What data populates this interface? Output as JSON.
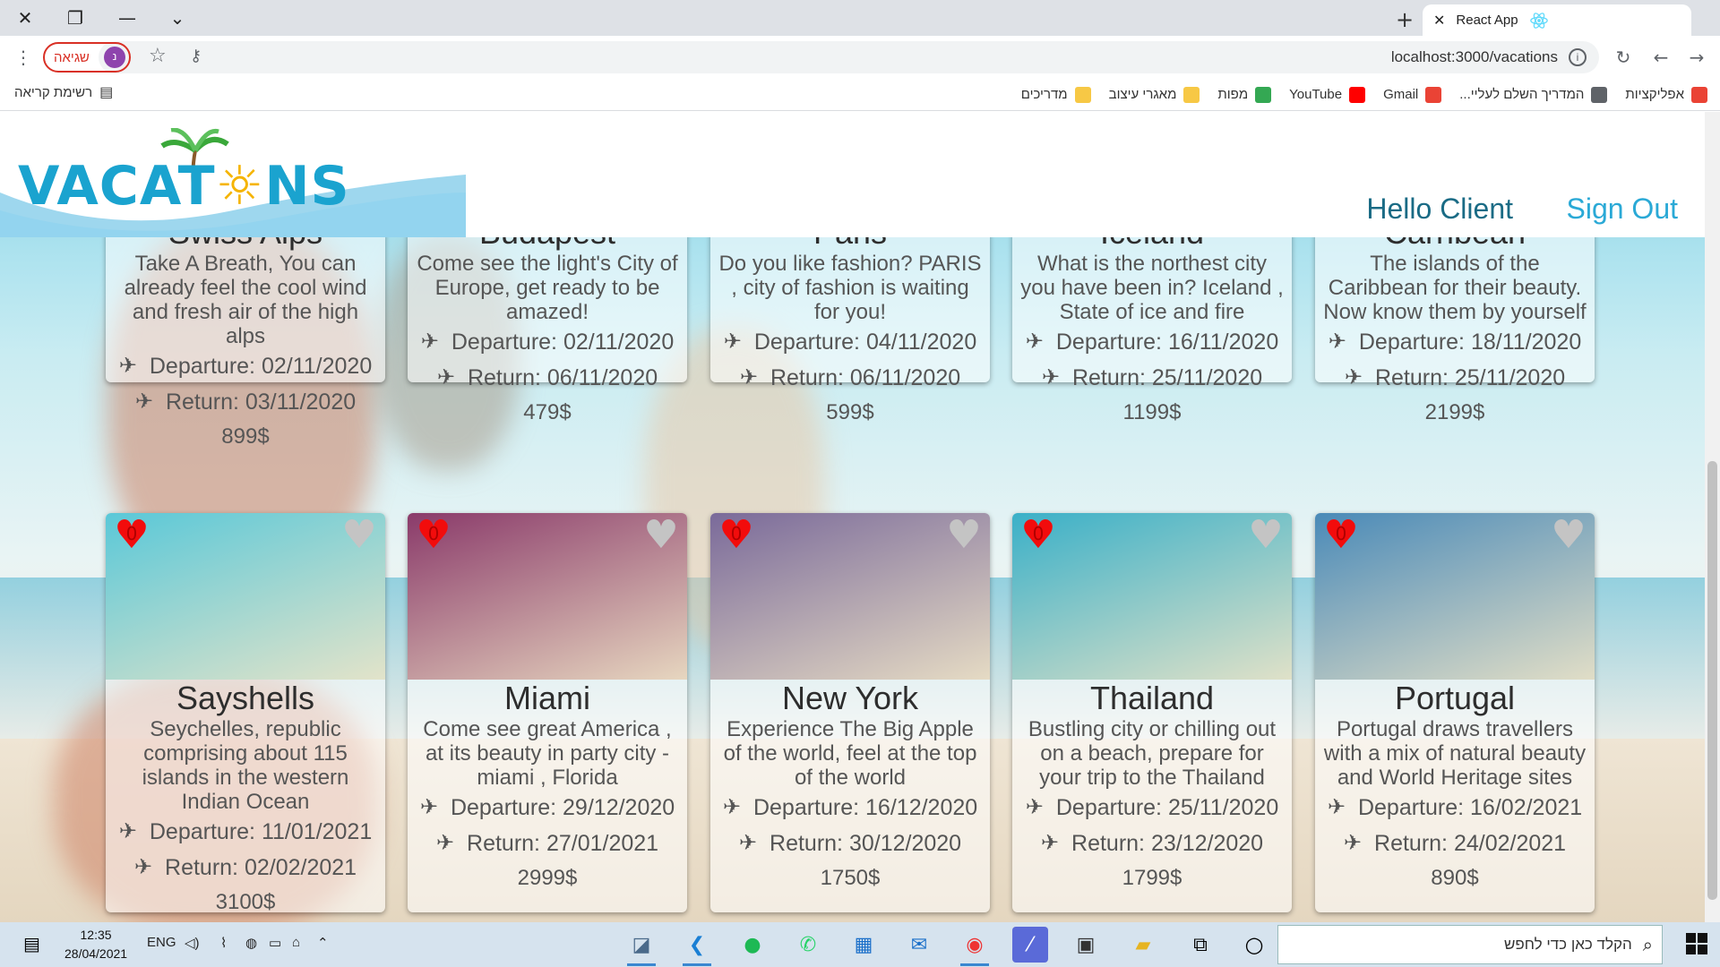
{
  "browser": {
    "tab_title": "React App",
    "url": "localhost:3000/vacations",
    "profile_error": "שגיאה",
    "profile_initial": "נ",
    "bookmarks": [
      {
        "label": "אפליקציות",
        "icon": "apps-grid-icon",
        "color": "#ea4335"
      },
      {
        "label": "המדריך השלם לעליי...",
        "icon": "globe-icon",
        "color": "#5f6368"
      },
      {
        "label": "Gmail",
        "icon": "gmail-icon",
        "color": "#ea4335"
      },
      {
        "label": "YouTube",
        "icon": "youtube-icon",
        "color": "#ff0000"
      },
      {
        "label": "מפות",
        "icon": "maps-icon",
        "color": "#34a853"
      },
      {
        "label": "מאגרי עיצוב",
        "icon": "folder-icon",
        "color": "#f7c845"
      },
      {
        "label": "מדריכים",
        "icon": "folder-icon",
        "color": "#f7c845"
      }
    ],
    "reading_list": "רשימת קריאה"
  },
  "header": {
    "logo_text_left": "VACAT",
    "logo_text_right": "NS",
    "greeting": "Hello Client",
    "sign_out": "Sign Out"
  },
  "labels": {
    "departure": "Departure:",
    "return": "Return:"
  },
  "vacations": [
    {
      "name": "Swiss Alps",
      "desc": "Take A Breath, You can already feel the cool wind and fresh air of the high alps",
      "departure": "02/11/2020",
      "return": "03/11/2020",
      "price": "899$",
      "img": "#4a7a3a"
    },
    {
      "name": "Budapest",
      "desc": "Come see the light's City of Europe, get ready to be amazed!",
      "departure": "02/11/2020",
      "return": "06/11/2020",
      "price": "479$",
      "img": "#2f4f7a"
    },
    {
      "name": "Paris",
      "desc": "Do you like fashion? PARIS , city of fashion is waiting for you!",
      "departure": "04/11/2020",
      "return": "06/11/2020",
      "price": "599$",
      "img": "#6a8a5a"
    },
    {
      "name": "Iceland",
      "desc": "What is the northest city you have been in? Iceland , State of ice and fire",
      "departure": "16/11/2020",
      "return": "25/11/2020",
      "price": "1199$",
      "img": "#3c6f82"
    },
    {
      "name": "Carribean",
      "desc": "The islands of the Caribbean for their beauty. Now know them by yourself",
      "departure": "18/11/2020",
      "return": "25/11/2020",
      "price": "2199$",
      "img": "#1fb5b0"
    },
    {
      "name": "Sayshells",
      "desc": "Seychelles, republic comprising about 115 islands in the western Indian Ocean",
      "departure": "11/01/2021",
      "return": "02/02/2021",
      "price": "3100$",
      "img": "#5ac8d8",
      "fav_count": "0"
    },
    {
      "name": "Miami",
      "desc": "Come see great America , at its beauty in party city - miami , Florida",
      "departure": "29/12/2020",
      "return": "27/01/2021",
      "price": "2999$",
      "img": "#8a3a6a",
      "fav_count": "0"
    },
    {
      "name": "New York",
      "desc": "Experience The Big Apple of the world, feel at the top of the world",
      "departure": "16/12/2020",
      "return": "30/12/2020",
      "price": "1750$",
      "img": "#7a6a9a",
      "fav_count": "0"
    },
    {
      "name": "Thailand",
      "desc": "Bustling city or chilling out on a beach, prepare for your trip to the Thailand",
      "departure": "25/11/2020",
      "return": "23/12/2020",
      "price": "1799$",
      "img": "#3ab0c8",
      "fav_count": "0"
    },
    {
      "name": "Portugal",
      "desc": "Portugal draws travellers with a mix of natural beauty and World Heritage sites",
      "departure": "16/02/2021",
      "return": "24/02/2021",
      "price": "890$",
      "img": "#4a8ab8",
      "fav_count": "0"
    }
  ],
  "taskbar": {
    "search_placeholder": "הקלד כאן כדי לחפש",
    "time": "12:35",
    "date": "28/04/2021",
    "language": "ENG"
  }
}
